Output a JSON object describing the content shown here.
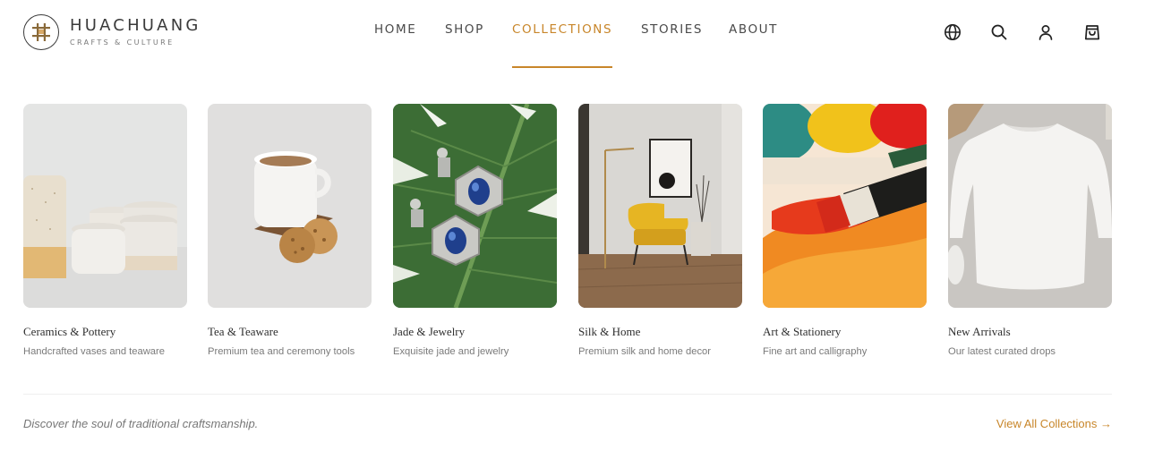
{
  "brand": {
    "name": "HUACHUANG",
    "tagline": "CRAFTS & CULTURE",
    "accent_color": "#c8862a"
  },
  "nav": {
    "items": [
      {
        "label": "HOME",
        "active": false
      },
      {
        "label": "SHOP",
        "active": false
      },
      {
        "label": "COLLECTIONS",
        "active": true
      },
      {
        "label": "STORIES",
        "active": false
      },
      {
        "label": "ABOUT",
        "active": false
      }
    ]
  },
  "header_icons": [
    "globe-icon",
    "search-icon",
    "user-icon",
    "bag-icon"
  ],
  "collections": [
    {
      "title": "Ceramics & Pottery",
      "description": "Handcrafted vases and teaware",
      "image": "ceramic-cups"
    },
    {
      "title": "Tea & Teaware",
      "description": "Premium tea and ceremony tools",
      "image": "tea-cup-cookies"
    },
    {
      "title": "Jade & Jewelry",
      "description": "Exquisite jade and jewelry",
      "image": "earrings-on-leaf"
    },
    {
      "title": "Silk & Home",
      "description": "Premium silk and home decor",
      "image": "yellow-armchair-room"
    },
    {
      "title": "Art & Stationery",
      "description": "Fine art and calligraphy",
      "image": "paint-brush"
    },
    {
      "title": "New Arrivals",
      "description": "Our latest curated drops",
      "image": "white-sweatshirt"
    }
  ],
  "footer": {
    "tagline": "Discover the soul of traditional craftsmanship.",
    "view_all_label": "View All Collections →"
  }
}
